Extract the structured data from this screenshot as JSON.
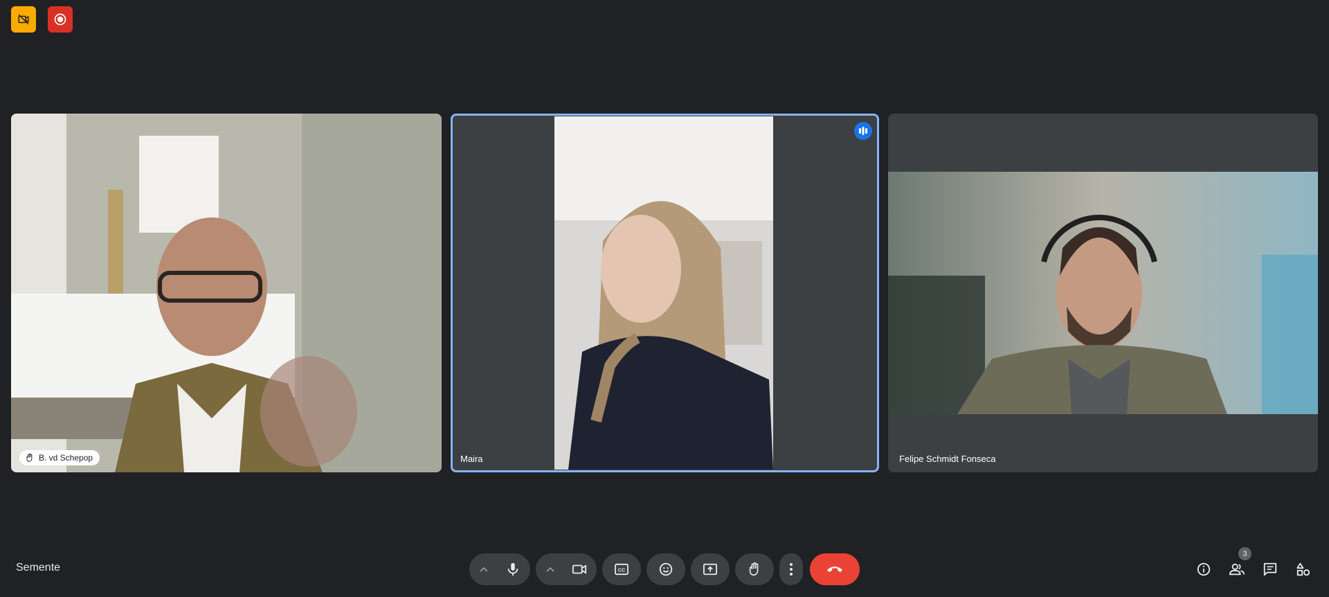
{
  "header": {
    "badges": [
      {
        "name": "camera-off-indicator",
        "color": "#f9ab00"
      },
      {
        "name": "recording-indicator",
        "color": "#d93025"
      }
    ]
  },
  "participants": [
    {
      "name": "B. vd Schepop",
      "hand_raised": true,
      "speaking": false
    },
    {
      "name": "Maira",
      "hand_raised": false,
      "speaking": true
    },
    {
      "name": "Felipe Schmidt Fonseca",
      "hand_raised": false,
      "speaking": false
    }
  ],
  "footer": {
    "meeting_name": "Semente",
    "participant_count": "3"
  },
  "controls": [
    "mic-options",
    "microphone",
    "camera-options",
    "camera",
    "captions",
    "reactions",
    "present-screen",
    "raise-hand",
    "more-options",
    "leave-call"
  ],
  "right_controls": [
    "meeting-details",
    "people",
    "chat",
    "activities"
  ],
  "colors": {
    "background": "#202124",
    "tile": "#3c4043",
    "active_speaker_border": "#8ab4f8",
    "leave_call": "#ea4335"
  }
}
